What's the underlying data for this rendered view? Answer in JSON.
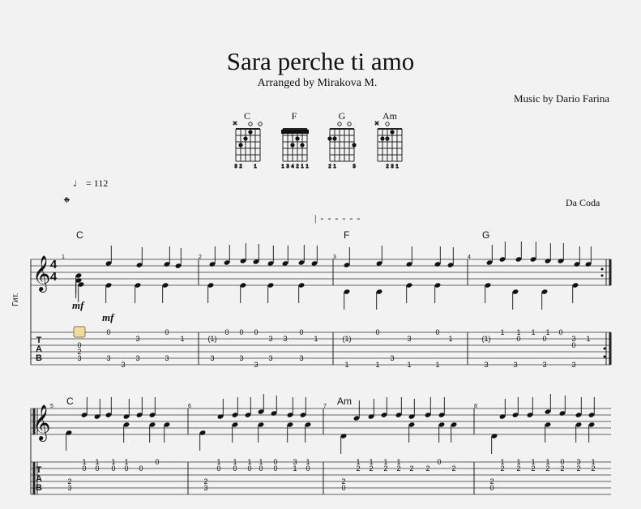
{
  "score": {
    "title": "Sara perche ti amo",
    "arranger": "Arranged by Mirakova M.",
    "composer": "Music by Dario Farina",
    "tempo_label": "= 112",
    "da_coda": "Da Coda",
    "repeat_text": "| - - - - - -",
    "instrument": "Гит.",
    "dynamic_1": "mf",
    "dynamic_2": "mf",
    "time_signature": [
      "4",
      "4"
    ],
    "tab_letters": [
      "T",
      "A",
      "B"
    ]
  },
  "chord_diagrams": [
    {
      "name": "C",
      "markers": "x  o o",
      "fingers": "3 2   1"
    },
    {
      "name": "F",
      "markers": "",
      "fingers": "1 3 4 2 1 1"
    },
    {
      "name": "G",
      "markers": "  o o o",
      "fingers": "2 1    3"
    },
    {
      "name": "Am",
      "markers": "x o    o",
      "fingers": "  2 3 1"
    }
  ],
  "system1": {
    "chords": [
      "C",
      "F",
      "G"
    ],
    "measure_numbers": [
      "1",
      "2",
      "3",
      "4"
    ]
  },
  "system2": {
    "chords": [
      "C",
      "Am"
    ],
    "measure_numbers": [
      "5",
      "6",
      "7",
      "8"
    ]
  },
  "tab_system1": {
    "m1": {
      "s1": [
        "0",
        "0"
      ],
      "s2": [
        "3",
        "1"
      ],
      "s3": [
        "0"
      ],
      "s4": [
        "2",
        "3",
        "3",
        "3"
      ],
      "s5": [
        "3",
        "3"
      ],
      "pre": [
        "0",
        "2",
        "3"
      ]
    },
    "m2": {
      "s1": [
        "0",
        "0",
        "0",
        "0"
      ],
      "s2": [
        "(1)",
        "3",
        "3",
        "1"
      ],
      "s4": [
        "3",
        "3",
        "3",
        "3"
      ],
      "s5": [
        "3"
      ]
    },
    "m3": {
      "s1": [
        "0",
        "0"
      ],
      "s2": [
        "(1)",
        "3",
        "1"
      ],
      "s4": [
        "3"
      ],
      "s5": [
        "1",
        "1",
        "1",
        "1"
      ]
    },
    "m4": {
      "s1": [
        "1",
        "1",
        "1",
        "1",
        "0"
      ],
      "s2": [
        "(1)",
        "0",
        "0",
        "3",
        "1"
      ],
      "s3": [
        "0"
      ],
      "s5": [
        "3",
        "3",
        "3",
        "3"
      ]
    }
  },
  "tab_system2": {
    "m5": {
      "s1": [
        "1",
        "1",
        "1",
        "1"
      ],
      "s2": [
        "0",
        "0",
        "0",
        "0",
        "0"
      ],
      "pre": [
        "2",
        "3"
      ]
    },
    "m6": {
      "s1": [
        "1",
        "1",
        "1",
        "0"
      ],
      "s2": [
        "0",
        "0",
        "0",
        "0",
        "0",
        "3",
        "1"
      ],
      "pre": [
        "2",
        "3"
      ]
    },
    "m7": {
      "s1": [
        "1",
        "1",
        "1",
        "1",
        "0"
      ],
      "s2": [
        "2",
        "2",
        "2",
        "2",
        "2",
        "2",
        "2"
      ],
      "pre": [
        "2",
        "0"
      ]
    },
    "m8": {
      "s1": [
        "1",
        "1",
        "1",
        "1",
        "0"
      ],
      "s2": [
        "2",
        "2",
        "2",
        "2",
        "2",
        "2",
        "2"
      ],
      "pre": [
        "2",
        "0"
      ]
    }
  }
}
